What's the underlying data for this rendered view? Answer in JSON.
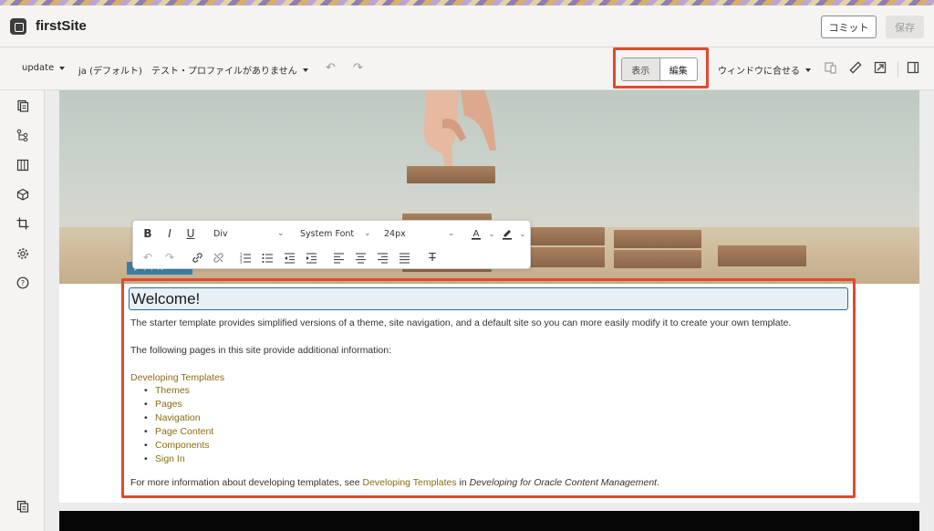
{
  "app": {
    "site_name": "firstSite"
  },
  "header": {
    "commit_label": "コミット",
    "save_label": "保存"
  },
  "toolbar": {
    "update_label": "update",
    "language_label": "ja (デフォルト)",
    "profile_label": "テスト・プロファイルがありません",
    "view_mode": {
      "view_label": "表示",
      "edit_label": "編集",
      "selected": "表示"
    },
    "fit_label": "ウィンドウに合せる"
  },
  "sidebar": {
    "icons": [
      "pages-icon",
      "site-structure-icon",
      "layout-columns-icon",
      "components-cube-icon",
      "crop-icon",
      "settings-gear-icon",
      "help-icon"
    ],
    "bottom_icon": "copy-pages-icon"
  },
  "editor_toolbar": {
    "block_format": "Div",
    "font_family": "System Font",
    "font_size": "24px",
    "bold": "B",
    "italic": "I",
    "underline": "U",
    "clear_format": "T"
  },
  "component_tag": {
    "label": "タイトル",
    "menu": "···"
  },
  "content": {
    "heading": "Welcome!",
    "intro": "The starter template provides simplified versions of a theme, site navigation, and a default site so you can more easily modify it to create your own template.",
    "pages_intro": "The following pages in this site provide additional information:",
    "section_link": "Developing Templates",
    "pages": [
      "Themes",
      "Pages",
      "Navigation",
      "Page Content",
      "Components",
      "Sign In"
    ],
    "footer_prefix": "For more information about developing templates, see ",
    "footer_link": "Developing Templates",
    "footer_mid": " in ",
    "footer_book": "Developing for Oracle Content Management",
    "footer_end": "."
  },
  "colors": {
    "highlight": "#e04a2f",
    "link": "#8a6d12",
    "accent": "#2a6a9b"
  }
}
